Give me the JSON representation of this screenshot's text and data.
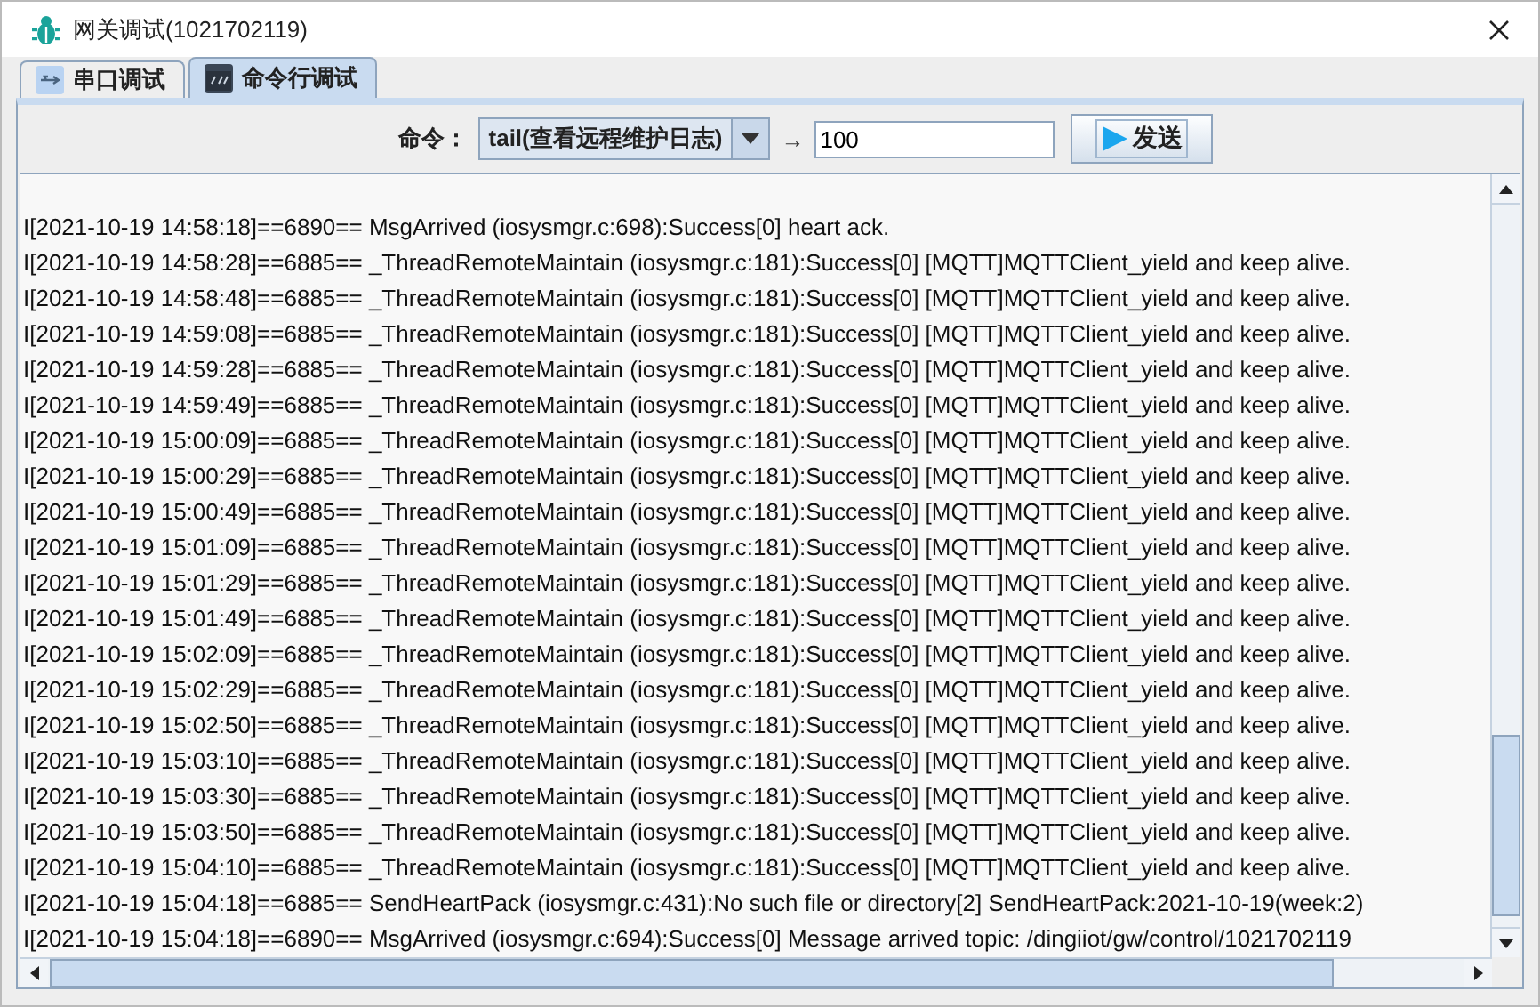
{
  "window": {
    "title": "网关调试(1021702119)"
  },
  "tabs": [
    {
      "label": "串口调试",
      "selected": false
    },
    {
      "label": "命令行调试",
      "selected": true
    }
  ],
  "command": {
    "label": "命令：",
    "value": "tail(查看远程维护日志)",
    "arrow": "→",
    "count": "100",
    "send": "发送"
  },
  "log": [
    "I[2021-10-19 14:58:18]==6890== MsgArrived (iosysmgr.c:698):Success[0] heart ack.",
    "I[2021-10-19 14:58:28]==6885== _ThreadRemoteMaintain (iosysmgr.c:181):Success[0] [MQTT]MQTTClient_yield and keep alive.",
    "I[2021-10-19 14:58:48]==6885== _ThreadRemoteMaintain (iosysmgr.c:181):Success[0] [MQTT]MQTTClient_yield and keep alive.",
    "I[2021-10-19 14:59:08]==6885== _ThreadRemoteMaintain (iosysmgr.c:181):Success[0] [MQTT]MQTTClient_yield and keep alive.",
    "I[2021-10-19 14:59:28]==6885== _ThreadRemoteMaintain (iosysmgr.c:181):Success[0] [MQTT]MQTTClient_yield and keep alive.",
    "I[2021-10-19 14:59:49]==6885== _ThreadRemoteMaintain (iosysmgr.c:181):Success[0] [MQTT]MQTTClient_yield and keep alive.",
    "I[2021-10-19 15:00:09]==6885== _ThreadRemoteMaintain (iosysmgr.c:181):Success[0] [MQTT]MQTTClient_yield and keep alive.",
    "I[2021-10-19 15:00:29]==6885== _ThreadRemoteMaintain (iosysmgr.c:181):Success[0] [MQTT]MQTTClient_yield and keep alive.",
    "I[2021-10-19 15:00:49]==6885== _ThreadRemoteMaintain (iosysmgr.c:181):Success[0] [MQTT]MQTTClient_yield and keep alive.",
    "I[2021-10-19 15:01:09]==6885== _ThreadRemoteMaintain (iosysmgr.c:181):Success[0] [MQTT]MQTTClient_yield and keep alive.",
    "I[2021-10-19 15:01:29]==6885== _ThreadRemoteMaintain (iosysmgr.c:181):Success[0] [MQTT]MQTTClient_yield and keep alive.",
    "I[2021-10-19 15:01:49]==6885== _ThreadRemoteMaintain (iosysmgr.c:181):Success[0] [MQTT]MQTTClient_yield and keep alive.",
    "I[2021-10-19 15:02:09]==6885== _ThreadRemoteMaintain (iosysmgr.c:181):Success[0] [MQTT]MQTTClient_yield and keep alive.",
    "I[2021-10-19 15:02:29]==6885== _ThreadRemoteMaintain (iosysmgr.c:181):Success[0] [MQTT]MQTTClient_yield and keep alive.",
    "I[2021-10-19 15:02:50]==6885== _ThreadRemoteMaintain (iosysmgr.c:181):Success[0] [MQTT]MQTTClient_yield and keep alive.",
    "I[2021-10-19 15:03:10]==6885== _ThreadRemoteMaintain (iosysmgr.c:181):Success[0] [MQTT]MQTTClient_yield and keep alive.",
    "I[2021-10-19 15:03:30]==6885== _ThreadRemoteMaintain (iosysmgr.c:181):Success[0] [MQTT]MQTTClient_yield and keep alive.",
    "I[2021-10-19 15:03:50]==6885== _ThreadRemoteMaintain (iosysmgr.c:181):Success[0] [MQTT]MQTTClient_yield and keep alive.",
    "I[2021-10-19 15:04:10]==6885== _ThreadRemoteMaintain (iosysmgr.c:181):Success[0] [MQTT]MQTTClient_yield and keep alive.",
    "I[2021-10-19 15:04:18]==6885== SendHeartPack (iosysmgr.c:431):No such file or directory[2] SendHeartPack:2021-10-19(week:2)",
    "I[2021-10-19 15:04:18]==6890== MsgArrived (iosysmgr.c:694):Success[0] Message arrived topic: /dingiiot/gw/control/1021702119"
  ]
}
